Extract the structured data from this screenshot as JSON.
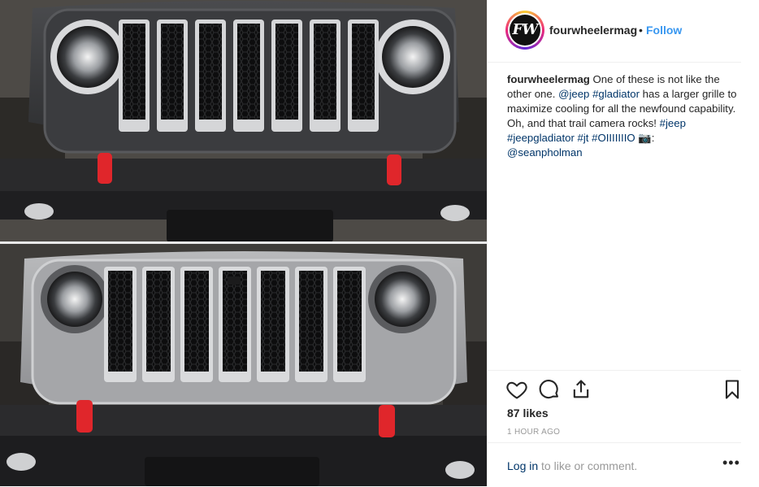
{
  "post": {
    "username": "fourwheelermag",
    "avatar_text": "FW",
    "separator": "•",
    "follow_label": "Follow",
    "caption": {
      "user": "fourwheelermag",
      "text_1": " One of these is not like the other one. ",
      "mention_jeep": "@jeep",
      "tag_gladiator": "#gladiator",
      "text_2": " has a larger grille to maximize cooling for all the newfound capability. Oh, and that trail camera rocks! ",
      "tag_jeep": "#jeep",
      "tag_jeepgladiator": "#jeepgladiator",
      "tag_jt": "#jt",
      "tag_olll": "#OIIIIIIIO",
      "camera_emoji": "📷",
      "text_3": ":",
      "mention_sean": "@seanpholman"
    },
    "likes": "87 likes",
    "time": "1 HOUR AGO",
    "login_link": "Log in",
    "login_rest": " to like or comment.",
    "more_label": "•••"
  },
  "icons": {
    "like": "heart-icon",
    "comment": "comment-bubble-icon",
    "share": "share-icon",
    "save": "bookmark-icon"
  },
  "colors": {
    "link": "#003569",
    "follow": "#3897f0",
    "muted": "#999999",
    "tow_hook": "#e0262b"
  }
}
